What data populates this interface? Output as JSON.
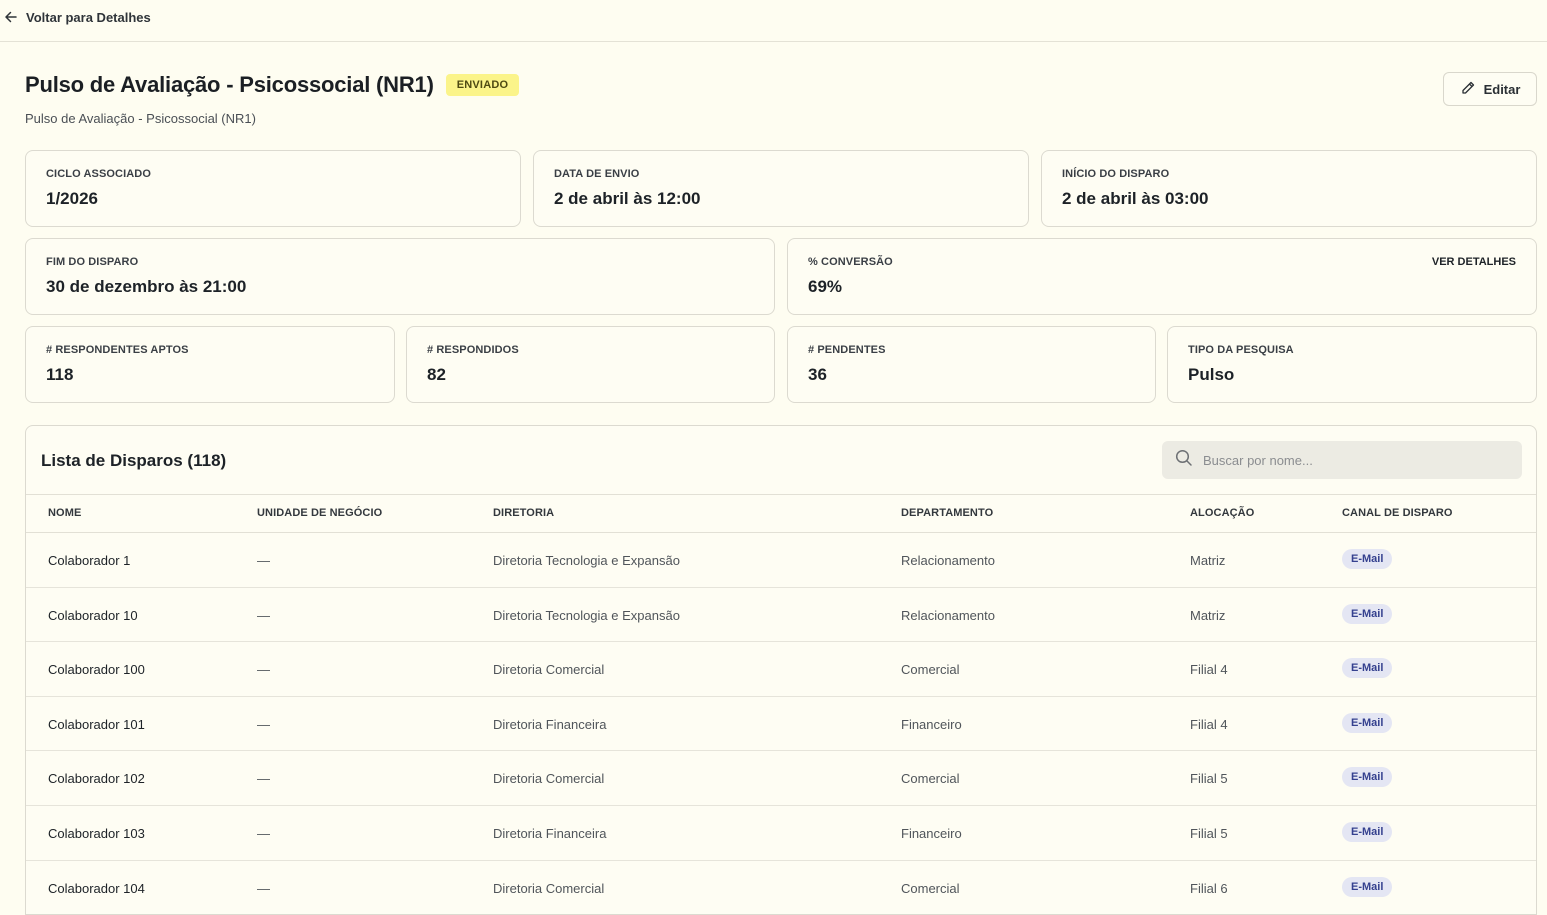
{
  "nav": {
    "back_label": "Voltar para Detalhes"
  },
  "header": {
    "title": "Pulso de Avaliação - Psicossocial (NR1)",
    "status": "ENVIADO",
    "subtitle": "Pulso de Avaliação - Psicossocial (NR1)",
    "edit_label": "Editar"
  },
  "cards": {
    "ciclo": {
      "label": "CICLO ASSOCIADO",
      "value": "1/2026"
    },
    "data_envio": {
      "label": "DATA DE ENVIO",
      "value": "2 de abril às 12:00"
    },
    "inicio": {
      "label": "INÍCIO DO DISPARO",
      "value": "2 de abril às 03:00"
    },
    "fim": {
      "label": "FIM DO DISPARO",
      "value": "30 de dezembro às 21:00"
    },
    "conversao": {
      "label": "% CONVERSÃO",
      "value": "69%",
      "link": "VER DETALHES"
    },
    "aptos": {
      "label": "# RESPONDENTES APTOS",
      "value": "118"
    },
    "respondidos": {
      "label": "# RESPONDIDOS",
      "value": "82"
    },
    "pendentes": {
      "label": "# PENDENTES",
      "value": "36"
    },
    "tipo": {
      "label": "TIPO DA PESQUISA",
      "value": "Pulso"
    }
  },
  "table": {
    "title": "Lista de Disparos (118)",
    "search_placeholder": "Buscar por nome...",
    "columns": [
      "NOME",
      "UNIDADE DE NEGÓCIO",
      "DIRETORIA",
      "DEPARTAMENTO",
      "ALOCAÇÃO",
      "CANAL DE DISPARO"
    ],
    "rows": [
      [
        "Colaborador 1",
        "—",
        "Diretoria Tecnologia e Expansão",
        "Relacionamento",
        "Matriz",
        "E-Mail"
      ],
      [
        "Colaborador 10",
        "—",
        "Diretoria Tecnologia e Expansão",
        "Relacionamento",
        "Matriz",
        "E-Mail"
      ],
      [
        "Colaborador 100",
        "—",
        "Diretoria Comercial",
        "Comercial",
        "Filial 4",
        "E-Mail"
      ],
      [
        "Colaborador 101",
        "—",
        "Diretoria Financeira",
        "Financeiro",
        "Filial 4",
        "E-Mail"
      ],
      [
        "Colaborador 102",
        "—",
        "Diretoria Comercial",
        "Comercial",
        "Filial 5",
        "E-Mail"
      ],
      [
        "Colaborador 103",
        "—",
        "Diretoria Financeira",
        "Financeiro",
        "Filial 5",
        "E-Mail"
      ],
      [
        "Colaborador 104",
        "—",
        "Diretoria Comercial",
        "Comercial",
        "Filial 6",
        "E-Mail"
      ]
    ]
  }
}
